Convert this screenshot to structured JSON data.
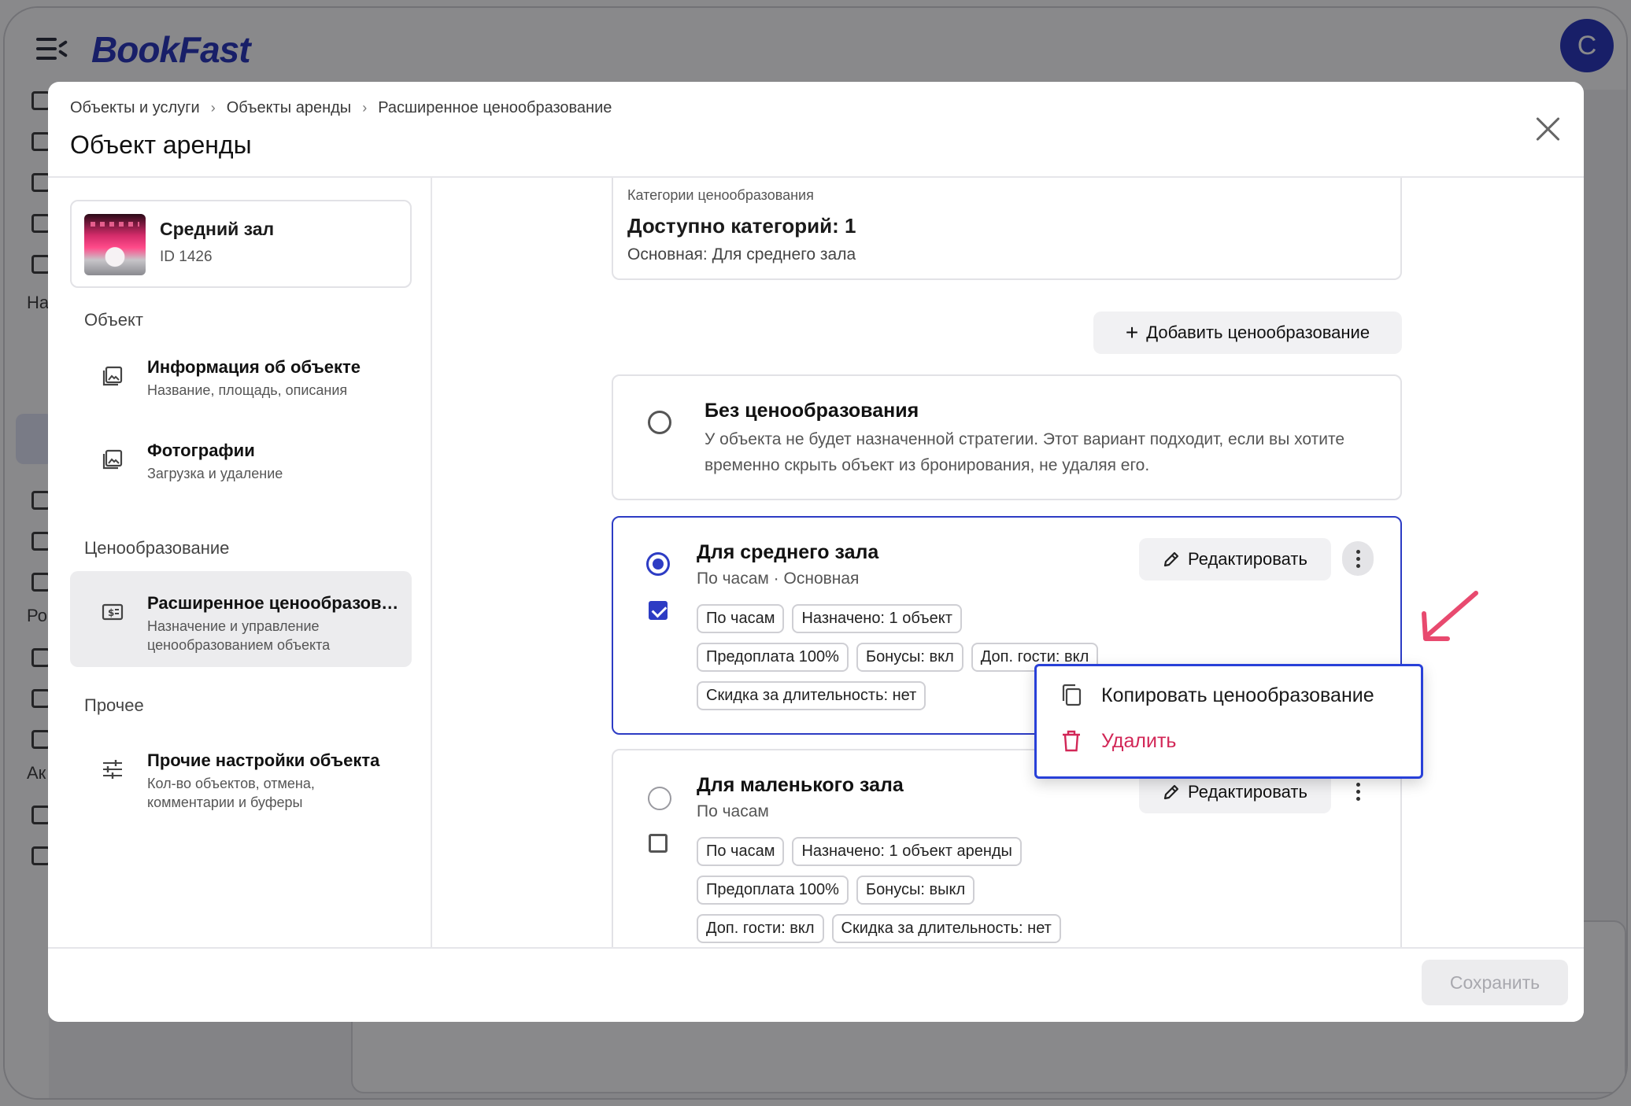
{
  "app": {
    "logo": "BookFast",
    "avatar_letter": "C"
  },
  "rail": {
    "labels": [
      "На",
      "Ро",
      "Ак"
    ]
  },
  "breadcrumb": [
    "Объекты и услуги",
    "Объекты аренды",
    "Расширенное ценообразование"
  ],
  "modal": {
    "title": "Объект аренды"
  },
  "object": {
    "name": "Средний зал",
    "id": "ID 1426"
  },
  "sidebar": {
    "sections": [
      "Объект",
      "Ценообразование",
      "Прочее"
    ],
    "items": [
      {
        "title": "Информация об объекте",
        "sub": "Название, площадь, описания",
        "icon": "image-icon"
      },
      {
        "title": "Фотографии",
        "sub": "Загрузка и удаление",
        "icon": "image-icon"
      },
      {
        "title": "Расширенное ценообразование",
        "sub": "Назначение и управление ценообразованием объекта",
        "icon": "price-tag-icon"
      },
      {
        "title": "Прочие настройки объекта",
        "sub": "Кол-во объектов, отмена, комментарии и буферы",
        "icon": "sliders-icon"
      }
    ]
  },
  "categories": {
    "label": "Категории ценообразования",
    "title": "Доступно категорий: 1",
    "sub": "Основная: Для среднего зала"
  },
  "add_button": "Добавить ценообразование",
  "no_pricing": {
    "title": "Без ценообразования",
    "desc": "У объекта не будет назначенной стратегии. Этот вариант подходит, если вы хотите временно скрыть объект из бронирования, не удаляя его."
  },
  "pricing_cards": [
    {
      "title": "Для среднего зала",
      "sub": "По часам · Основная",
      "chips": [
        "По часам",
        "Назначено: 1 объект",
        "Предоплата 100%",
        "Бонусы: вкл",
        "Доп. гости: вкл",
        "Скидка за длительность: нет"
      ]
    },
    {
      "title": "Для маленького зала",
      "sub": "По часам",
      "chips": [
        "По часам",
        "Назначено: 1 объект аренды",
        "Предоплата 100%",
        "Бонусы: выкл",
        "Доп. гости: вкл",
        "Скидка за длительность: нет"
      ]
    }
  ],
  "edit_label": "Редактировать",
  "menu": {
    "copy": "Копировать ценообразование",
    "delete": "Удалить"
  },
  "save_label": "Сохранить",
  "colors": {
    "accent": "#2d3cc4",
    "danger": "#d22757",
    "annotation": "#e84a6f"
  }
}
